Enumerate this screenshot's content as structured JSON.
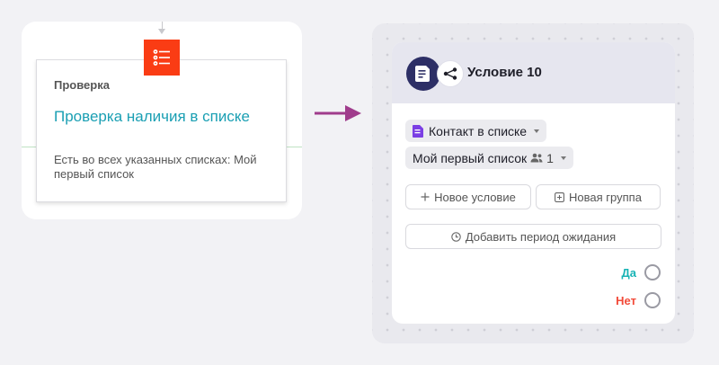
{
  "old_node": {
    "label": "Проверка",
    "title": "Проверка наличия в списке",
    "description": "Есть во всех указанных списках: Мой первый список",
    "badge_color": "#fa3c14",
    "title_color": "#1a9fb3"
  },
  "arrow_color": "#a03c8c",
  "new_node": {
    "title": "Условие 10",
    "condition_label": "Контакт в списке",
    "list_label": "Мой первый список",
    "list_count": "1",
    "add_condition": "Новое условие",
    "add_group": "Новая группа",
    "add_delay": "Добавить период ожидания",
    "yes_label": "Да",
    "no_label": "Нет",
    "yes_color": "#17b3b5",
    "no_color": "#f24b3a",
    "avatar_color": "#2d2f66",
    "condition_icon_color": "#7b3fe4"
  }
}
